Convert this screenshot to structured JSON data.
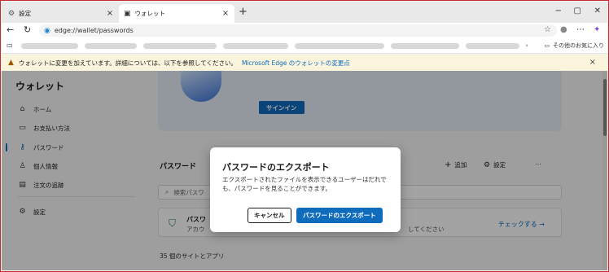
{
  "tabs": [
    {
      "label": "設定",
      "icon": "gear-icon"
    },
    {
      "label": "ウォレット",
      "icon": "wallet-icon"
    }
  ],
  "address": {
    "url": "edge://wallet/passwords"
  },
  "favorites": {
    "other_label": "その他のお気に入り"
  },
  "banner": {
    "text": "ウォレットに変更を加えています。詳細については、以下を参照してください。",
    "link": "Microsoft Edge のウォレットの変更点"
  },
  "sidebar": {
    "title": "ウォレット",
    "items": [
      {
        "label": "ホーム",
        "icon": "home-icon"
      },
      {
        "label": "お支払い方法",
        "icon": "card-icon"
      },
      {
        "label": "パスワード",
        "icon": "key-icon"
      },
      {
        "label": "個人情報",
        "icon": "person-icon"
      },
      {
        "label": "注文の追跡",
        "icon": "order-icon"
      },
      {
        "label": "設定",
        "icon": "gear-icon"
      }
    ]
  },
  "main": {
    "signin_label": "サインイン",
    "passwords_title": "パスワード",
    "add_label": "追加",
    "settings_label": "設定",
    "search_placeholder": "検索パスワ",
    "health_title": "パスワ",
    "health_sub": "アカウ",
    "health_sub_right": "してください",
    "check_label": "チェックする →",
    "site_count": "35 個のサイトとアプリ"
  },
  "dialog": {
    "title": "パスワードのエクスポート",
    "body": "エクスポートされたファイルを表示できるユーザーはだれでも、パスワードを見ることができます。",
    "cancel": "キャンセル",
    "export": "パスワードのエクスポート"
  }
}
